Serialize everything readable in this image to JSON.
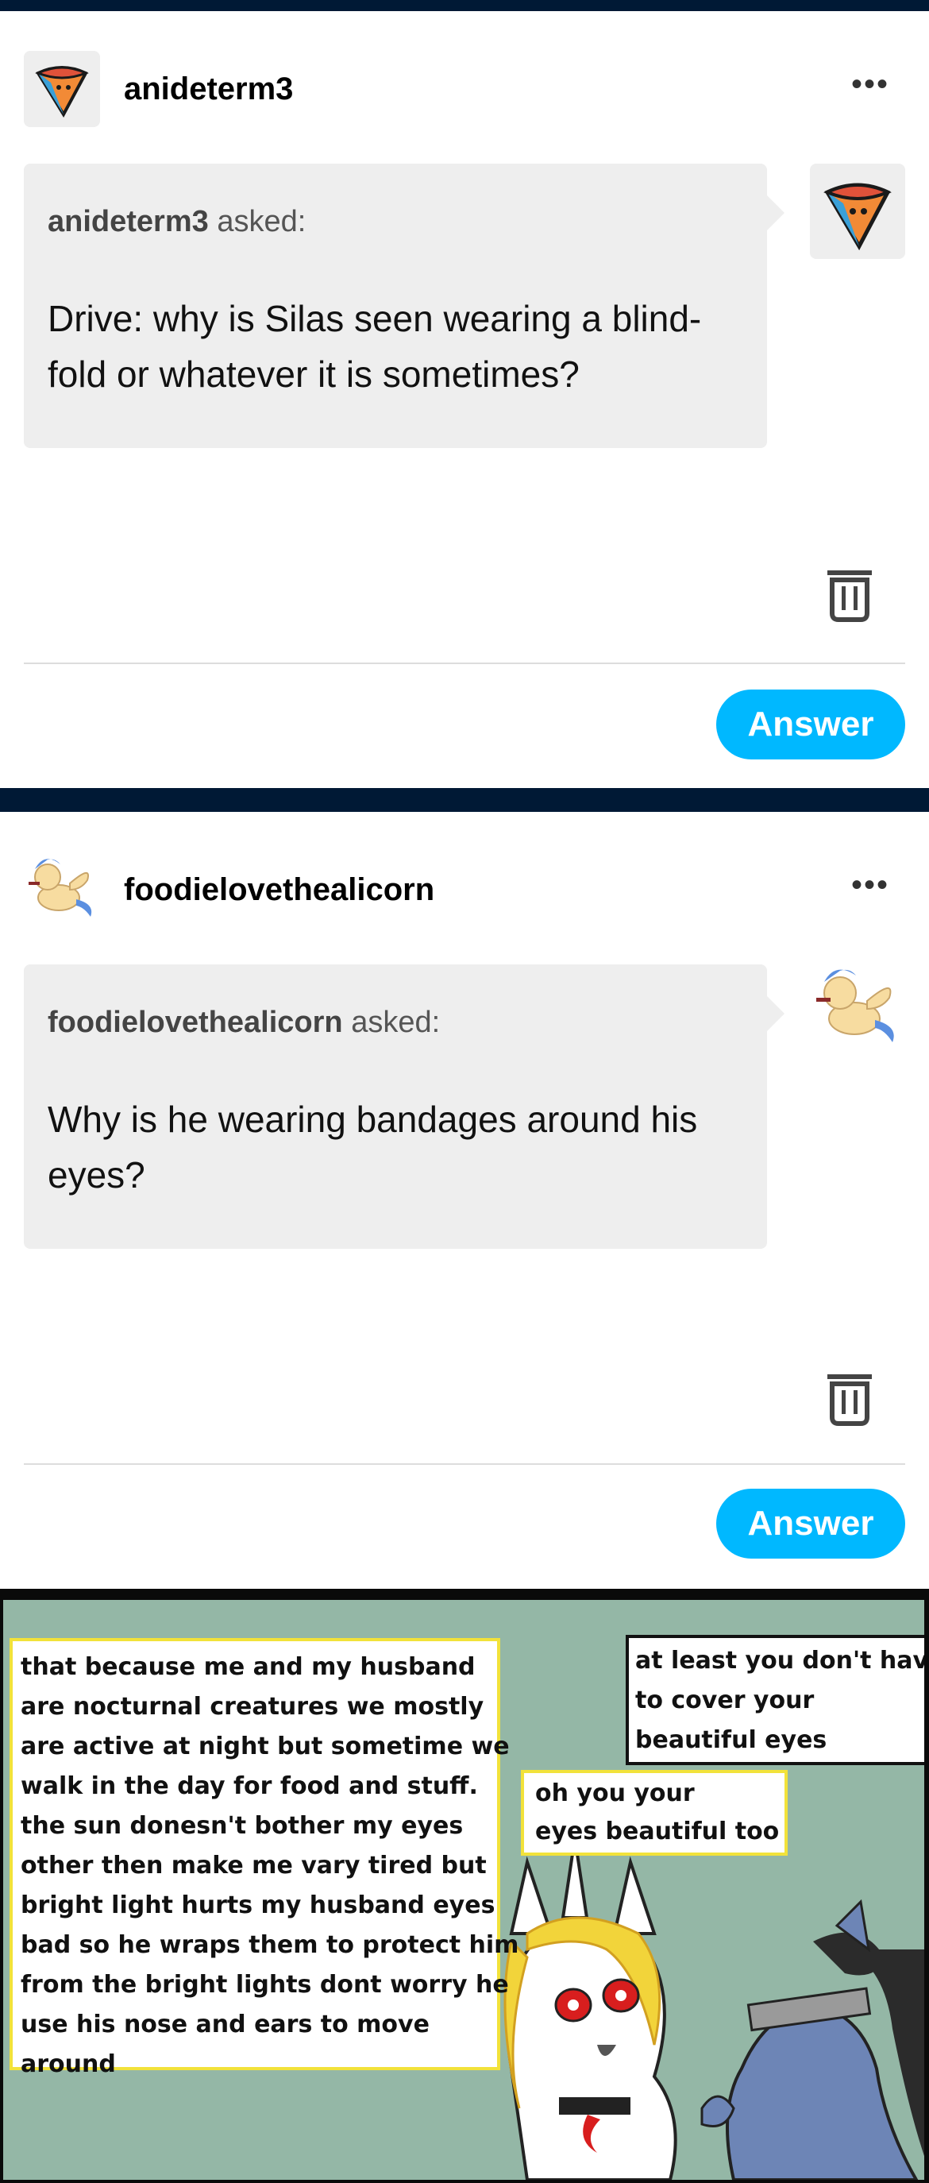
{
  "posts": [
    {
      "username": "anideterm3",
      "more_label": "•••",
      "asker": "anideterm3",
      "asked_label": "asked:",
      "question_lines": [
        "Drive: why is Silas seen wearing a blind-",
        "fold or whatever it is sometimes?"
      ],
      "answer_label": "Answer"
    },
    {
      "username": "foodielovethealicorn",
      "more_label": "•••",
      "asker": "foodielovethealicorn",
      "asked_label": "asked:",
      "question_lines": [
        "Why is he wearing bandages around his",
        "eyes?"
      ],
      "answer_label": "Answer"
    }
  ],
  "comic": {
    "left_box": [
      "that because me and my husband",
      "are nocturnal creatures we mostly",
      "are active at night but sometime we",
      "walk in the day for food and stuff.",
      "the sun donesn't bother my eyes",
      "other then make me vary tired but",
      "bright light hurts my husband eyes",
      "bad so he wraps them to protect him",
      "from the bright lights dont worry he",
      "use his nose and ears to move",
      "around"
    ],
    "top_right_box": [
      "at least you don't have",
      "to cover your",
      "beautiful eyes"
    ],
    "mid_box": [
      "oh you your",
      "eyes beautiful too"
    ]
  },
  "colors": {
    "nav": "#001935",
    "answer_button": "#00b8ff",
    "bubble": "#eeeeee",
    "comic_bg": "#94b7a6",
    "speech_border": "#f2e23a"
  },
  "icons": [
    "avatar-cone-icon",
    "more-icon",
    "trash-icon",
    "avatar-pony-icon"
  ]
}
